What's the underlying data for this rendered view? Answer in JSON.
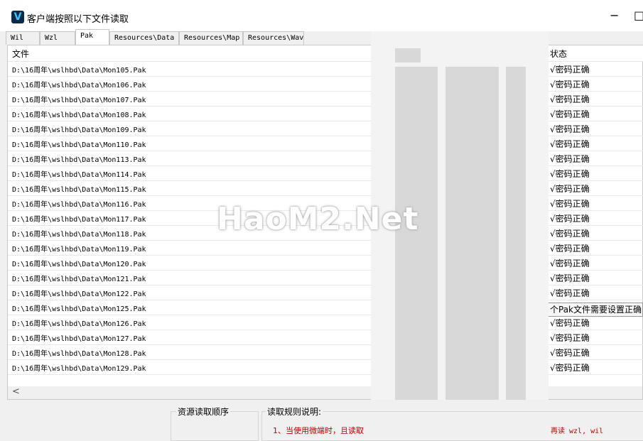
{
  "window": {
    "title": "客户端按照以下文件读取",
    "icon_letter": "V",
    "minimize_glyph": "−",
    "maximize_glyph": "□"
  },
  "tabs": [
    {
      "label": "Wil"
    },
    {
      "label": "Wzl"
    },
    {
      "label": "Pak",
      "active": true
    },
    {
      "label": "Resources\\Data"
    },
    {
      "label": "Resources\\Map"
    },
    {
      "label": "Resources\\Wav"
    }
  ],
  "table": {
    "columns": {
      "file": "文件",
      "status": "状态"
    },
    "rows": [
      {
        "path": "D:\\16周年\\wslhbd\\Data\\Mon105.Pak",
        "status": "√密码正确"
      },
      {
        "path": "D:\\16周年\\wslhbd\\Data\\Mon106.Pak",
        "status": "√密码正确"
      },
      {
        "path": "D:\\16周年\\wslhbd\\Data\\Mon107.Pak",
        "status": "√密码正确"
      },
      {
        "path": "D:\\16周年\\wslhbd\\Data\\Mon108.Pak",
        "status": "√密码正确"
      },
      {
        "path": "D:\\16周年\\wslhbd\\Data\\Mon109.Pak",
        "status": "√密码正确"
      },
      {
        "path": "D:\\16周年\\wslhbd\\Data\\Mon110.Pak",
        "status": "√密码正确"
      },
      {
        "path": "D:\\16周年\\wslhbd\\Data\\Mon113.Pak",
        "status": "√密码正确"
      },
      {
        "path": "D:\\16周年\\wslhbd\\Data\\Mon114.Pak",
        "status": "√密码正确"
      },
      {
        "path": "D:\\16周年\\wslhbd\\Data\\Mon115.Pak",
        "status": "√密码正确"
      },
      {
        "path": "D:\\16周年\\wslhbd\\Data\\Mon116.Pak",
        "status": "√密码正确"
      },
      {
        "path": "D:\\16周年\\wslhbd\\Data\\Mon117.Pak",
        "status": "√密码正确"
      },
      {
        "path": "D:\\16周年\\wslhbd\\Data\\Mon118.Pak",
        "status": "√密码正确"
      },
      {
        "path": "D:\\16周年\\wslhbd\\Data\\Mon119.Pak",
        "status": "√密码正确"
      },
      {
        "path": "D:\\16周年\\wslhbd\\Data\\Mon120.Pak",
        "status": "√密码正确"
      },
      {
        "path": "D:\\16周年\\wslhbd\\Data\\Mon121.Pak",
        "status": "√密码正确"
      },
      {
        "path": "D:\\16周年\\wslhbd\\Data\\Mon122.Pak",
        "status": "√密码正确"
      },
      {
        "path": "D:\\16周年\\wslhbd\\Data\\Mon125.Pak",
        "status": ""
      },
      {
        "path": "D:\\16周年\\wslhbd\\Data\\Mon126.Pak",
        "status": "√密码正确"
      },
      {
        "path": "D:\\16周年\\wslhbd\\Data\\Mon127.Pak",
        "status": "√密码正确"
      },
      {
        "path": "D:\\16周年\\wslhbd\\Data\\Mon128.Pak",
        "status": "√密码正确"
      },
      {
        "path": "D:\\16周年\\wslhbd\\Data\\Mon129.Pak",
        "status": "√密码正确"
      }
    ],
    "scroll_left_glyph": "<"
  },
  "tooltip": {
    "text": "个Pak文件需要设置正确"
  },
  "watermark": {
    "text": "HaoM2.Net"
  },
  "bottom": {
    "order_title": "资源读取顺序",
    "rules_title": "读取规则说明:",
    "rule1": "1、当使用微端时，且读取",
    "rule1_tail": "再读 wzl, wil"
  }
}
